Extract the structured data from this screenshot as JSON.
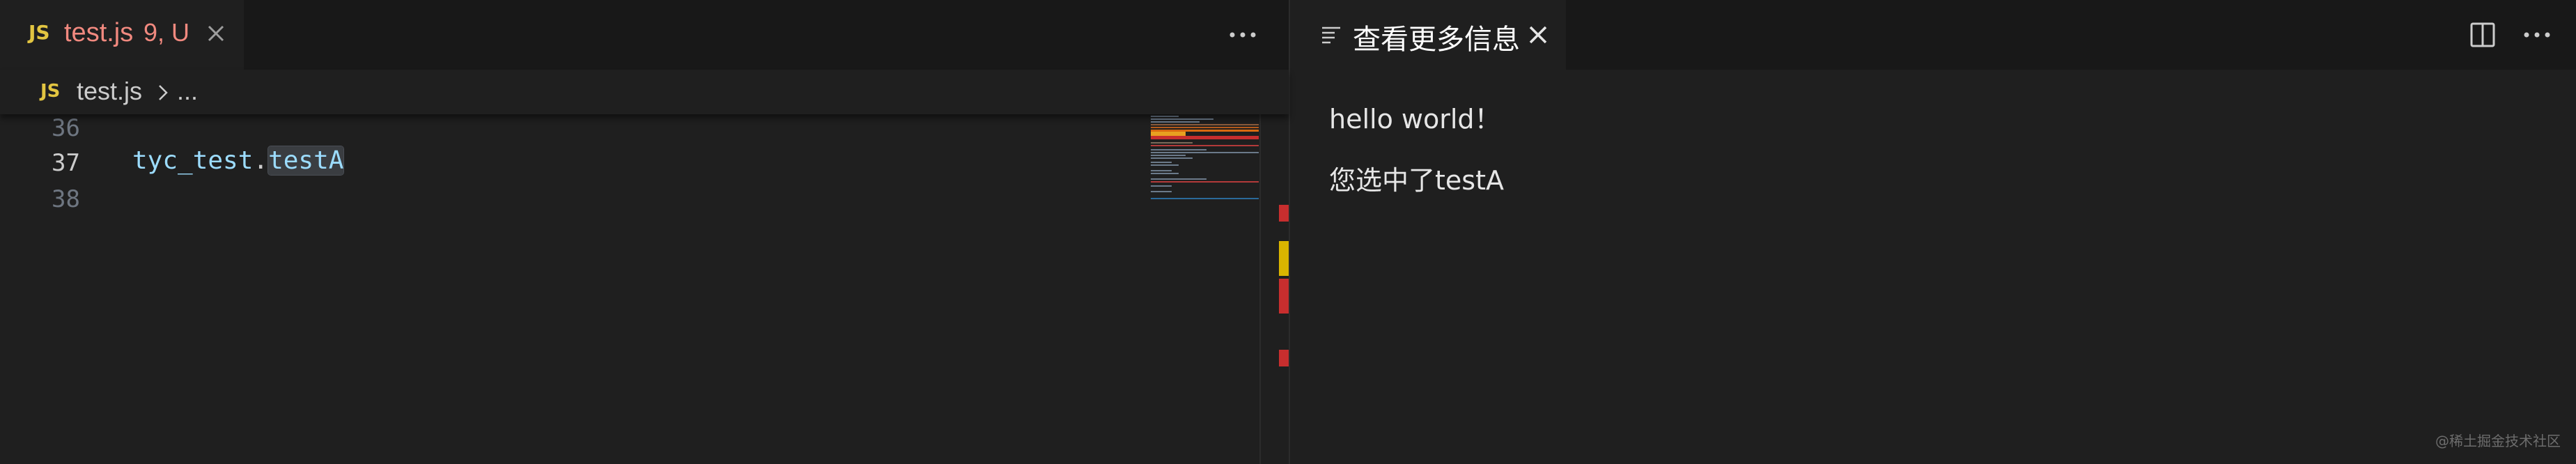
{
  "left_editor": {
    "tab": {
      "icon_label": "JS",
      "icon_name": "javascript-file-icon",
      "filename": "test.js",
      "status": "9, U",
      "close_icon": "close-icon"
    },
    "more_actions_icon": "more-actions-icon",
    "breadcrumb": {
      "icon_label": "JS",
      "filename": "test.js",
      "separator_icon": "chevron-right-icon",
      "ellipsis": "..."
    },
    "lines": [
      {
        "number": "36",
        "code": ""
      },
      {
        "number": "37",
        "code_object": "tyc_test",
        "code_dot": ".",
        "code_member": "testA"
      },
      {
        "number": "38",
        "code": ""
      }
    ]
  },
  "right_panel": {
    "tab": {
      "icon_name": "preview-icon",
      "title": "查看更多信息",
      "close_icon": "close-icon"
    },
    "split_editor_icon": "split-editor-icon",
    "more_actions_icon": "more-actions-icon",
    "content": {
      "line1": "hello world！",
      "line2": "您选中了testA"
    },
    "watermark": "@稀土掘金技术社区"
  },
  "colors": {
    "background": "#1f1f1f",
    "tabbar": "#181818",
    "tab_modified": "#f1897f",
    "js_icon": "#e2c541",
    "code_variable": "#9cdcfe",
    "overview_error": "#c72e2e",
    "overview_warning": "#d9b400"
  }
}
